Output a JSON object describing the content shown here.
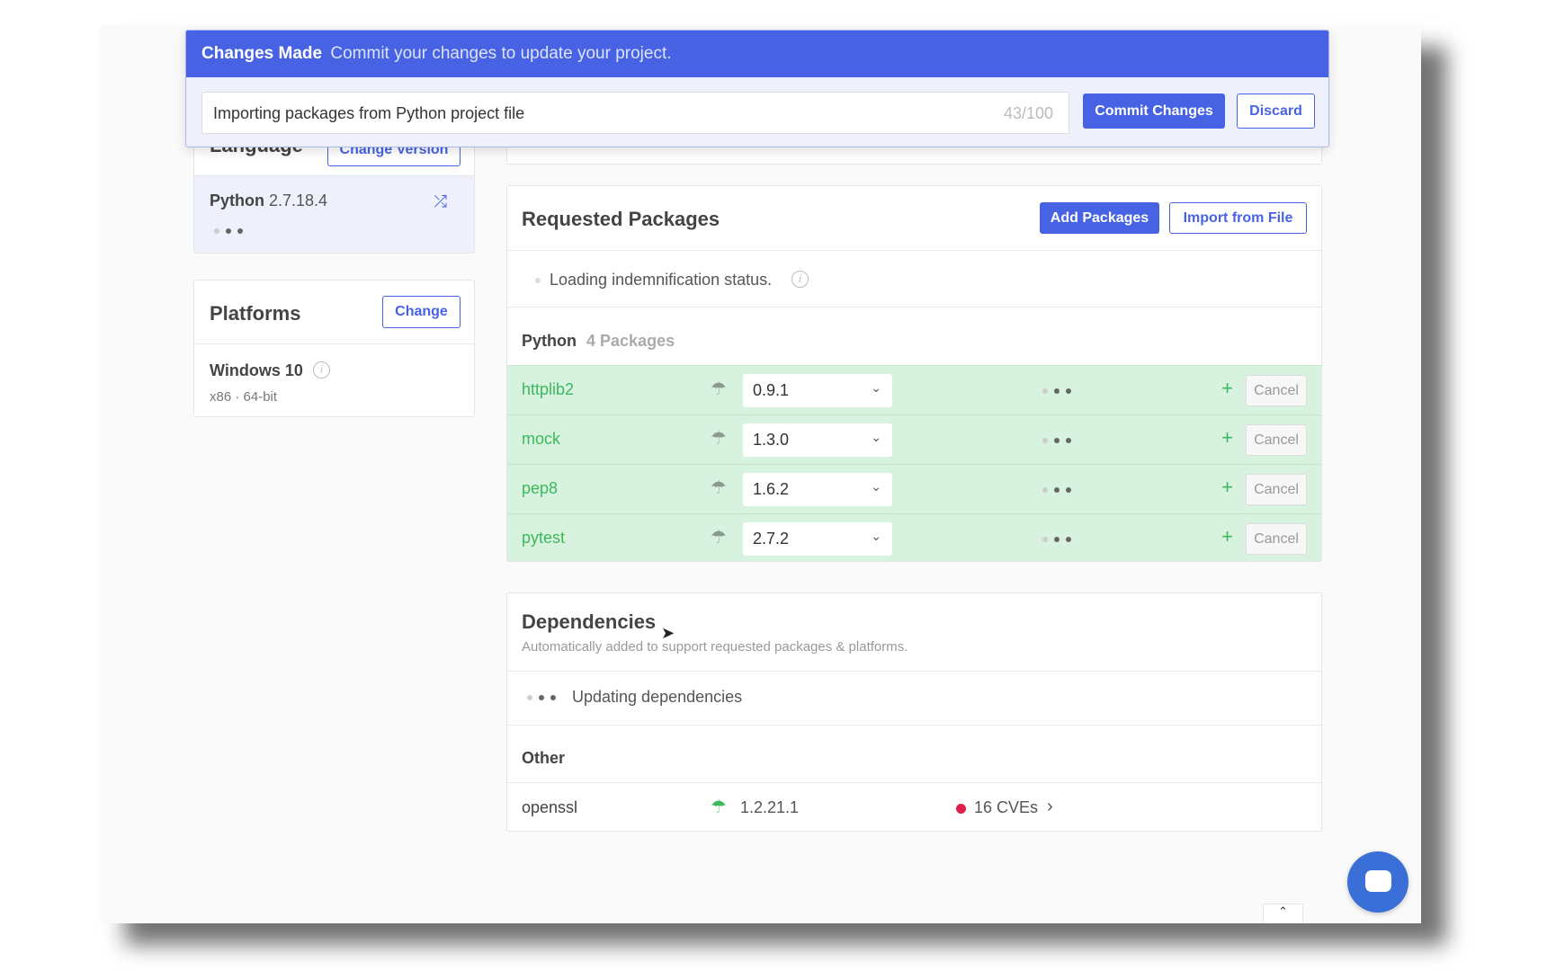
{
  "banner": {
    "title": "Changes Made",
    "subtitle": "Commit your changes to update your project.",
    "message": "Importing packages from Python project file",
    "counter": "43/100",
    "commit_label": "Commit Changes",
    "discard_label": "Discard"
  },
  "language": {
    "title": "Language",
    "change_label": "Change Version",
    "name": "Python",
    "version": "2.7.18.4"
  },
  "platforms": {
    "title": "Platforms",
    "change_label": "Change",
    "os": "Windows 10",
    "arch": "x86 · 64-bit"
  },
  "requested": {
    "title": "Requested Packages",
    "add_label": "Add Packages",
    "import_label": "Import from File",
    "loading": "Loading indemnification status.",
    "group": "Python",
    "group_count": "4 Packages",
    "packages": [
      {
        "name": "httplib2",
        "version": "0.9.1"
      },
      {
        "name": "mock",
        "version": "1.3.0"
      },
      {
        "name": "pep8",
        "version": "1.6.2"
      },
      {
        "name": "pytest",
        "version": "2.7.2"
      }
    ],
    "cancel_label": "Cancel"
  },
  "dependencies": {
    "title": "Dependencies",
    "subtitle": "Automatically added to support requested packages & platforms.",
    "updating": "Updating dependencies",
    "group": "Other",
    "items": [
      {
        "name": "openssl",
        "version": "1.2.21.1",
        "cves": "16 CVEs"
      }
    ]
  },
  "colors": {
    "accent": "#4763e4",
    "added_row": "#d8f2e0",
    "added_text": "#3cb95a",
    "cve_dot": "#e0204a"
  }
}
